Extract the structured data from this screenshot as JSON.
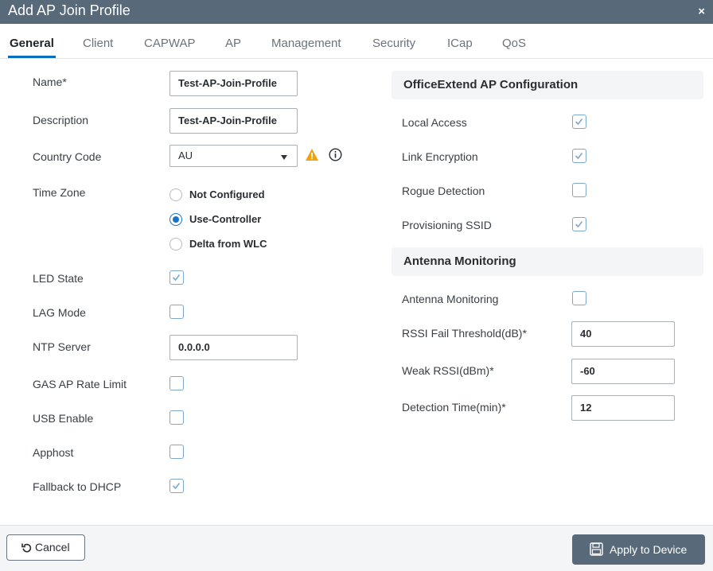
{
  "dialog": {
    "title": "Add AP Join Profile",
    "close_glyph": "×"
  },
  "tabs": [
    {
      "label": "General",
      "active": true
    },
    {
      "label": "Client"
    },
    {
      "label": "CAPWAP"
    },
    {
      "label": "AP"
    },
    {
      "label": "Management"
    },
    {
      "label": "Security"
    },
    {
      "label": "ICap"
    },
    {
      "label": "QoS"
    }
  ],
  "general": {
    "name": {
      "label": "Name*",
      "value": "Test-AP-Join-Profile"
    },
    "description": {
      "label": "Description",
      "value": "Test-AP-Join-Profile"
    },
    "country_code": {
      "label": "Country Code",
      "value": "AU",
      "warning_icon": "warning-icon",
      "info_icon": "info-icon"
    },
    "time_zone": {
      "label": "Time Zone",
      "options": [
        {
          "label": "Not Configured",
          "selected": false
        },
        {
          "label": "Use-Controller",
          "selected": true
        },
        {
          "label": "Delta from WLC",
          "selected": false
        }
      ]
    },
    "led_state": {
      "label": "LED State",
      "checked": true
    },
    "lag_mode": {
      "label": "LAG Mode",
      "checked": false
    },
    "ntp_server": {
      "label": "NTP Server",
      "value": "0.0.0.0"
    },
    "gas_ap_rate_limit": {
      "label": "GAS AP Rate Limit",
      "checked": false
    },
    "usb_enable": {
      "label": "USB Enable",
      "checked": false
    },
    "apphost": {
      "label": "Apphost",
      "checked": false
    },
    "fallback_dhcp": {
      "label": "Fallback to DHCP",
      "checked": true
    }
  },
  "office_extend": {
    "heading": "OfficeExtend AP Configuration",
    "local_access": {
      "label": "Local Access",
      "checked": true
    },
    "link_encryption": {
      "label": "Link Encryption",
      "checked": true
    },
    "rogue_detection": {
      "label": "Rogue Detection",
      "checked": false
    },
    "provisioning_ssid": {
      "label": "Provisioning SSID",
      "checked": true
    }
  },
  "antenna": {
    "heading": "Antenna Monitoring",
    "antenna_monitoring": {
      "label": "Antenna Monitoring",
      "checked": false
    },
    "rssi_fail": {
      "label": "RSSI Fail Threshold(dB)*",
      "value": "40"
    },
    "weak_rssi": {
      "label": "Weak RSSI(dBm)*",
      "value": "-60"
    },
    "detection_time": {
      "label": "Detection Time(min)*",
      "value": "12"
    }
  },
  "footer": {
    "cancel_label": "Cancel",
    "apply_label": "Apply to Device",
    "cancel_icon": "undo-icon",
    "apply_icon": "save-icon"
  },
  "colors": {
    "titlebar": "#58697a",
    "accent": "#0b6ebc",
    "warning": "#f0a30a",
    "checkbox_border": "#7fa9cc"
  }
}
